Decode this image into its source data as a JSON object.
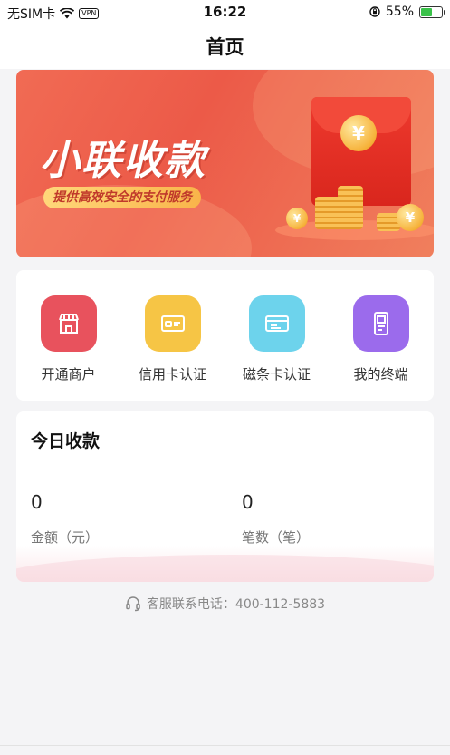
{
  "status_bar": {
    "carrier": "无SIM卡",
    "vpn": "VPN",
    "time": "16:22",
    "battery": "55%",
    "battery_level": 0.55
  },
  "header": {
    "title": "首页"
  },
  "banner": {
    "title": "小联收款",
    "tagline": "提供高效安全的支付服务",
    "coin_symbol": "¥"
  },
  "services": [
    {
      "label": "开通商户",
      "icon": "storefront-icon",
      "color": "#e8525d"
    },
    {
      "label": "信用卡认证",
      "icon": "credit-card-icon",
      "color": "#f6c545"
    },
    {
      "label": "磁条卡认证",
      "icon": "magstripe-card-icon",
      "color": "#6dd3ec"
    },
    {
      "label": "我的终端",
      "icon": "pos-terminal-icon",
      "color": "#9b6bec"
    }
  ],
  "today": {
    "title": "今日收款",
    "amount_value": "0",
    "amount_label": "金额（元）",
    "count_value": "0",
    "count_label": "笔数（笔）"
  },
  "hotline": {
    "text": "客服联系电话：400-112-5883"
  }
}
